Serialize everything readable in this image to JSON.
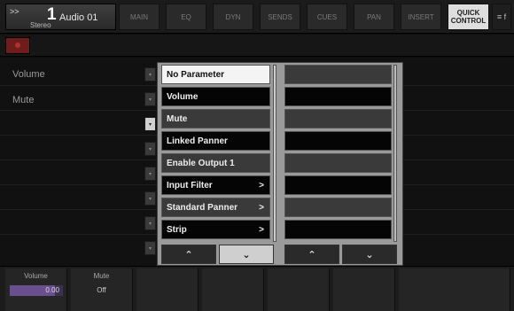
{
  "header": {
    "channel": {
      "arrow": ">>",
      "number": "1",
      "type": "Stereo",
      "name": "Audio 01"
    },
    "tabs": [
      {
        "label": "MAIN"
      },
      {
        "label": "EQ"
      },
      {
        "label": "DYN"
      },
      {
        "label": "SENDS"
      },
      {
        "label": "CUES"
      },
      {
        "label": "PAN"
      },
      {
        "label": "INSERT"
      },
      {
        "label": "QUICK CONTROL"
      }
    ],
    "menu_label": "≡ f"
  },
  "params": [
    {
      "label": "Volume"
    },
    {
      "label": "Mute"
    }
  ],
  "popup": {
    "items": [
      {
        "label": "No Parameter",
        "state": "selected",
        "submenu": false
      },
      {
        "label": "Volume",
        "state": "dark",
        "submenu": false
      },
      {
        "label": "Mute",
        "state": "mid",
        "submenu": false
      },
      {
        "label": "Linked Panner",
        "state": "dark",
        "submenu": false
      },
      {
        "label": "Enable Output 1",
        "state": "mid",
        "submenu": false
      },
      {
        "label": "Input Filter",
        "state": "dark",
        "submenu": true
      },
      {
        "label": "Standard Panner",
        "state": "mid",
        "submenu": true
      },
      {
        "label": "Strip",
        "state": "dark",
        "submenu": true
      }
    ],
    "chevron": ">",
    "nav": {
      "up": "⌃",
      "down": "⌄"
    }
  },
  "bottom": {
    "slots": [
      {
        "label": "Volume",
        "value": "0.00",
        "level": 0.85
      },
      {
        "label": "Mute",
        "value": "Off"
      }
    ]
  },
  "colors": {
    "active_tab": "#dedede",
    "record": "#6e1c1c",
    "volume_bar": "#6a4f8f"
  }
}
